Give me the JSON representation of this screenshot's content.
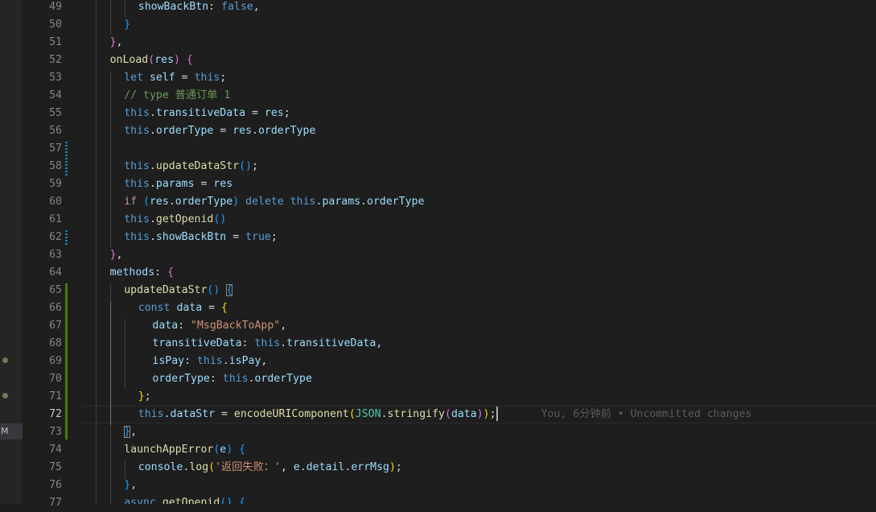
{
  "colors": {
    "background": "#1e1e1e",
    "keyword": "#569cd6",
    "control": "#c586c0",
    "variable": "#9cdcfe",
    "function": "#dcdcaa",
    "string": "#ce9178",
    "comment": "#6a9955",
    "git_modified": "#1b81a8",
    "git_added": "#487e02"
  },
  "activity": {
    "scm_badge": "M",
    "dot_icon": "modified-dot-icon"
  },
  "editor": {
    "active_line": "72",
    "line_numbers": [
      "49",
      "50",
      "51",
      "52",
      "53",
      "54",
      "55",
      "56",
      "57",
      "58",
      "59",
      "60",
      "61",
      "62",
      "63",
      "64",
      "65",
      "66",
      "67",
      "68",
      "69",
      "70",
      "71",
      "72",
      "73",
      "74",
      "75",
      "76",
      "77"
    ],
    "lines": [
      [
        [
          "}",
          "b2"
        ],
        [
          ",",
          ""
        ]
      ],
      [
        [
          "showBackBtn",
          "var"
        ],
        [
          ": ",
          ""
        ],
        [
          "false",
          "kw"
        ],
        [
          ",",
          ""
        ]
      ],
      [
        [
          "}",
          "b3"
        ]
      ],
      [
        [
          "}",
          "b2"
        ],
        [
          ",",
          ""
        ]
      ],
      [
        [
          "onLoad",
          "fn"
        ],
        [
          "(",
          "b2"
        ],
        [
          "res",
          "var"
        ],
        [
          ")",
          "b2"
        ],
        [
          " ",
          ""
        ],
        [
          "{",
          "b2"
        ]
      ],
      [
        [
          "let",
          "kw"
        ],
        [
          " ",
          ""
        ],
        [
          "self",
          "var"
        ],
        [
          " = ",
          ""
        ],
        [
          "this",
          "kw"
        ],
        [
          ";",
          ""
        ]
      ],
      [
        [
          "// type 普通订单 1",
          "cmt"
        ]
      ],
      [
        [
          "this",
          "kw"
        ],
        [
          ".",
          ""
        ],
        [
          "transitiveData",
          "var"
        ],
        [
          " = ",
          ""
        ],
        [
          "res",
          "var"
        ],
        [
          ";",
          ""
        ]
      ],
      [
        [
          "this",
          "kw"
        ],
        [
          ".",
          ""
        ],
        [
          "orderType",
          "var"
        ],
        [
          " = ",
          ""
        ],
        [
          "res",
          "var"
        ],
        [
          ".",
          ""
        ],
        [
          "orderType",
          "var"
        ]
      ],
      [],
      [
        [
          "this",
          "kw"
        ],
        [
          ".",
          ""
        ],
        [
          "updateDataStr",
          "fn"
        ],
        [
          "()",
          "b3"
        ],
        [
          ";",
          ""
        ]
      ],
      [
        [
          "this",
          "kw"
        ],
        [
          ".",
          ""
        ],
        [
          "params",
          "var"
        ],
        [
          " = ",
          ""
        ],
        [
          "res",
          "var"
        ]
      ],
      [
        [
          "if",
          "ctl"
        ],
        [
          " ",
          ""
        ],
        [
          "(",
          "b3"
        ],
        [
          "res",
          "var"
        ],
        [
          ".",
          ""
        ],
        [
          "orderType",
          "var"
        ],
        [
          ")",
          "b3"
        ],
        [
          " ",
          ""
        ],
        [
          "delete",
          "kw"
        ],
        [
          " ",
          ""
        ],
        [
          "this",
          "kw"
        ],
        [
          ".",
          ""
        ],
        [
          "params",
          "var"
        ],
        [
          ".",
          ""
        ],
        [
          "orderType",
          "var"
        ]
      ],
      [
        [
          "this",
          "kw"
        ],
        [
          ".",
          ""
        ],
        [
          "getOpenid",
          "fn"
        ],
        [
          "()",
          "b3"
        ]
      ],
      [
        [
          "this",
          "kw"
        ],
        [
          ".",
          ""
        ],
        [
          "showBackBtn",
          "var"
        ],
        [
          " = ",
          ""
        ],
        [
          "true",
          "kw"
        ],
        [
          ";",
          ""
        ]
      ],
      [
        [
          "}",
          "b2"
        ],
        [
          ",",
          ""
        ]
      ],
      [
        [
          "methods",
          "var"
        ],
        [
          ": ",
          ""
        ],
        [
          "{",
          "b2"
        ]
      ],
      [
        [
          "updateDataStr",
          "fn"
        ],
        [
          "()",
          "b3"
        ],
        [
          " ",
          ""
        ],
        [
          "{",
          "b3 bm"
        ]
      ],
      [
        [
          "const",
          "kw"
        ],
        [
          " ",
          ""
        ],
        [
          "data",
          "var"
        ],
        [
          " = ",
          ""
        ],
        [
          "{",
          "b1"
        ]
      ],
      [
        [
          "data",
          "var"
        ],
        [
          ": ",
          ""
        ],
        [
          "\"MsgBackToApp\"",
          "str"
        ],
        [
          ",",
          ""
        ]
      ],
      [
        [
          "transitiveData",
          "var"
        ],
        [
          ": ",
          ""
        ],
        [
          "this",
          "kw"
        ],
        [
          ".",
          ""
        ],
        [
          "transitiveData",
          "var"
        ],
        [
          ",",
          ""
        ]
      ],
      [
        [
          "isPay",
          "var"
        ],
        [
          ": ",
          ""
        ],
        [
          "this",
          "kw"
        ],
        [
          ".",
          ""
        ],
        [
          "isPay",
          "var"
        ],
        [
          ",",
          ""
        ]
      ],
      [
        [
          "orderType",
          "var"
        ],
        [
          ": ",
          ""
        ],
        [
          "this",
          "kw"
        ],
        [
          ".",
          ""
        ],
        [
          "orderType",
          "var"
        ]
      ],
      [
        [
          "}",
          "b1"
        ],
        [
          ";",
          ""
        ]
      ],
      [
        [
          "this",
          "kw"
        ],
        [
          ".",
          ""
        ],
        [
          "dataStr",
          "var"
        ],
        [
          " = ",
          ""
        ],
        [
          "encodeURIComponent",
          "fn"
        ],
        [
          "(",
          "b1"
        ],
        [
          "JSON",
          "cls"
        ],
        [
          ".",
          ""
        ],
        [
          "stringify",
          "fn"
        ],
        [
          "(",
          "b2"
        ],
        [
          "data",
          "var"
        ],
        [
          ")",
          "b2"
        ],
        [
          ")",
          "b1"
        ],
        [
          ";",
          ""
        ]
      ],
      [
        [
          "}",
          "b3 bm"
        ],
        [
          ",",
          ""
        ]
      ],
      [
        [
          "launchAppError",
          "fn"
        ],
        [
          "(",
          "b3"
        ],
        [
          "e",
          "var"
        ],
        [
          ")",
          "b3"
        ],
        [
          " ",
          ""
        ],
        [
          "{",
          "b3"
        ]
      ],
      [
        [
          "console",
          "var"
        ],
        [
          ".",
          ""
        ],
        [
          "log",
          "fn"
        ],
        [
          "(",
          "b1"
        ],
        [
          "'返回失败：'",
          "str"
        ],
        [
          ", ",
          ""
        ],
        [
          "e",
          "var"
        ],
        [
          ".",
          ""
        ],
        [
          "detail",
          "var"
        ],
        [
          ".",
          ""
        ],
        [
          "errMsg",
          "var"
        ],
        [
          ")",
          "b1"
        ],
        [
          ";",
          ""
        ]
      ],
      [
        [
          "}",
          "b3"
        ],
        [
          ",",
          ""
        ]
      ],
      [
        [
          "async",
          "kw"
        ],
        [
          " ",
          ""
        ],
        [
          "getOpenid",
          "fn"
        ],
        [
          "()",
          "b3"
        ],
        [
          " ",
          ""
        ],
        [
          "{",
          "b3"
        ]
      ]
    ],
    "blame": "You, 6分钟前 • Uncommitted changes"
  }
}
